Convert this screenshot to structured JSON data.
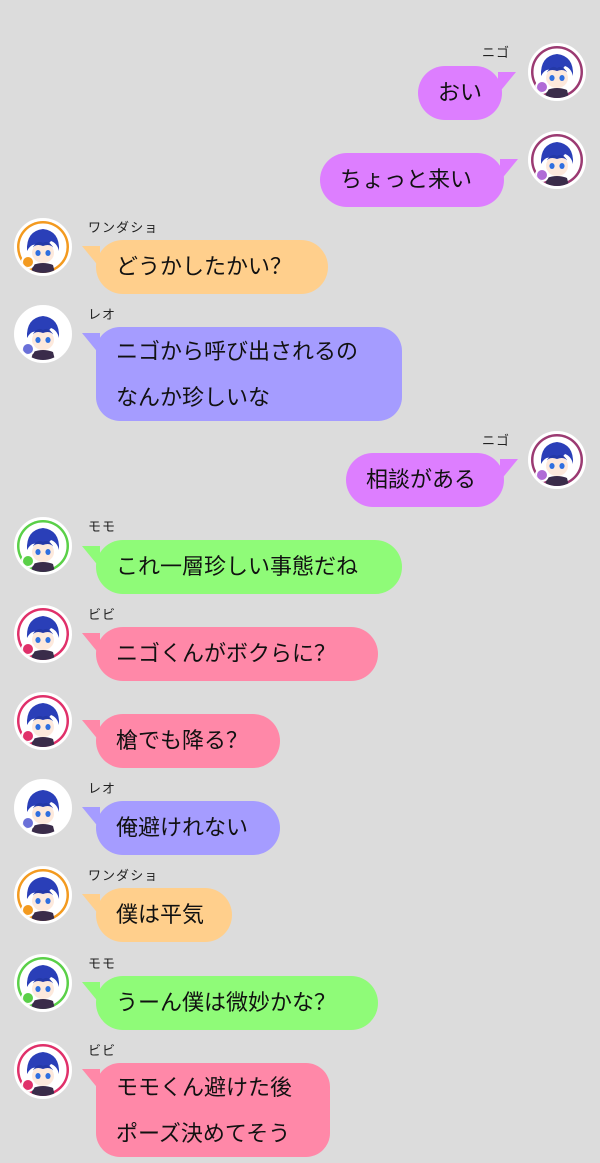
{
  "messages": [
    {
      "side": "right",
      "speaker": "ニゴ",
      "lines": [
        "おい"
      ],
      "color": "#dd7eff",
      "ring": "#9b3a72",
      "badge": "#b06bd6"
    },
    {
      "side": "right",
      "speaker": "",
      "lines": [
        "ちょっと来い"
      ],
      "color": "#dd7eff",
      "ring": "#9b3a72",
      "badge": "#b06bd6"
    },
    {
      "side": "left",
      "speaker": "ワンダショ",
      "lines": [
        "どうかしたかい？"
      ],
      "color": "#ffcf8c",
      "ring": "#f39a1f",
      "badge": "#f39a1f"
    },
    {
      "side": "left",
      "speaker": "レオ",
      "lines": [
        "ニゴから呼び出されるの",
        "なんか珍しいな"
      ],
      "color": "#a59cff",
      "ring": "#ffffff",
      "badge": "#6a70d8"
    },
    {
      "side": "right",
      "speaker": "ニゴ",
      "lines": [
        "相談がある"
      ],
      "color": "#dd7eff",
      "ring": "#9b3a72",
      "badge": "#b06bd6"
    },
    {
      "side": "left",
      "speaker": "モモ",
      "lines": [
        "これ一層珍しい事態だね"
      ],
      "color": "#8ffb78",
      "ring": "#5ad048",
      "badge": "#5ad048"
    },
    {
      "side": "left",
      "speaker": "ビビ",
      "lines": [
        "ニゴくんがボクらに？"
      ],
      "color": "#ff88a8",
      "ring": "#e0306a",
      "badge": "#e0306a"
    },
    {
      "side": "left",
      "speaker": "",
      "lines": [
        "槍でも降る？"
      ],
      "color": "#ff88a8",
      "ring": "#e0306a",
      "badge": "#e0306a"
    },
    {
      "side": "left",
      "speaker": "レオ",
      "lines": [
        "俺避けれない"
      ],
      "color": "#a59cff",
      "ring": "#ffffff",
      "badge": "#6a70d8"
    },
    {
      "side": "left",
      "speaker": "ワンダショ",
      "lines": [
        "僕は平気"
      ],
      "color": "#ffcf8c",
      "ring": "#f39a1f",
      "badge": "#f39a1f"
    },
    {
      "side": "left",
      "speaker": "モモ",
      "lines": [
        "うーん僕は微妙かな？"
      ],
      "color": "#8ffb78",
      "ring": "#5ad048",
      "badge": "#5ad048"
    },
    {
      "side": "left",
      "speaker": "ビビ",
      "lines": [
        "モモくん避けた後",
        "ポーズ決めてそう"
      ],
      "color": "#ff88a8",
      "ring": "#e0306a",
      "badge": "#e0306a"
    }
  ]
}
